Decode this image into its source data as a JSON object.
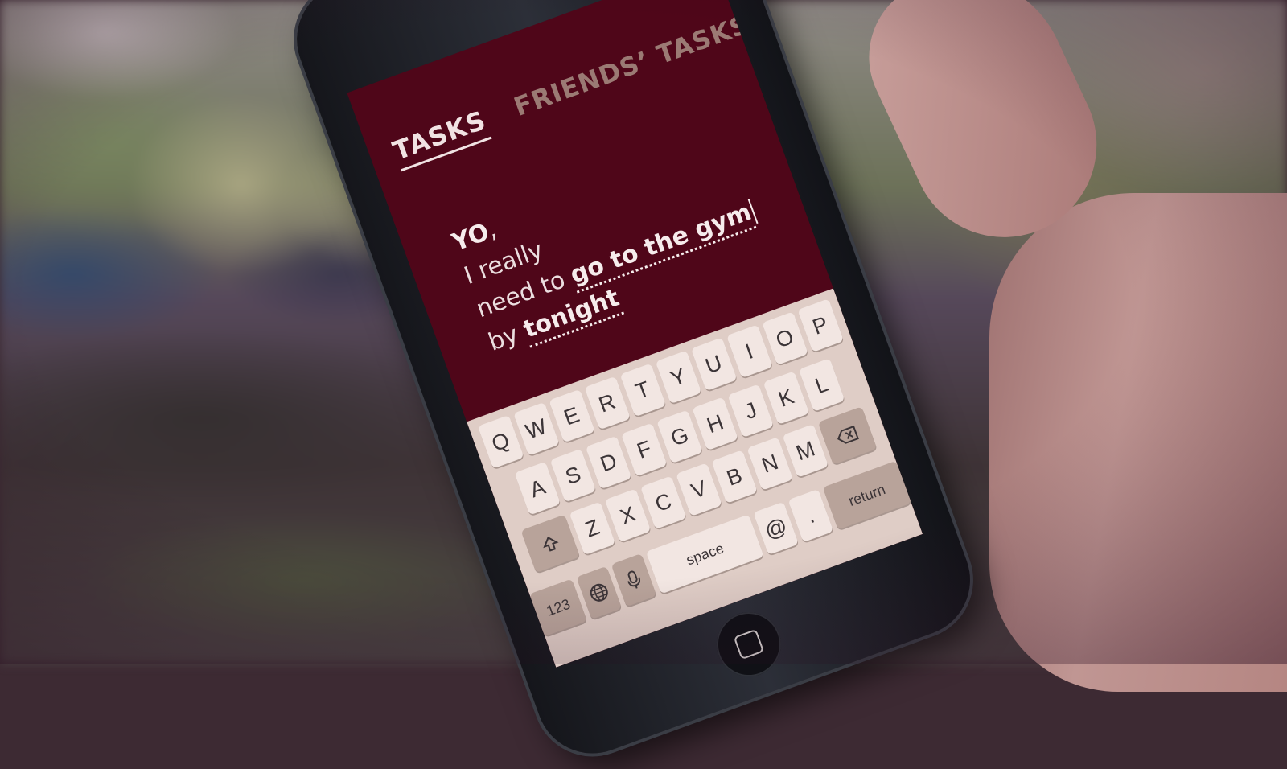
{
  "app": {
    "tabs": [
      {
        "label": "TASKS",
        "active": true
      },
      {
        "label": "FRIENDS’ TASKS",
        "active": false
      }
    ],
    "message": {
      "greeting": "YO",
      "comma": ",",
      "line1": "I really",
      "line2_prefix": "need to",
      "task": "go to the gym",
      "line3_prefix": "by",
      "deadline": "tonight"
    },
    "accent_color": "#4f0619"
  },
  "keyboard": {
    "row1": [
      "Q",
      "W",
      "E",
      "R",
      "T",
      "Y",
      "U",
      "I",
      "O",
      "P"
    ],
    "row2": [
      "A",
      "S",
      "D",
      "F",
      "G",
      "H",
      "J",
      "K",
      "L"
    ],
    "row3": [
      "Z",
      "X",
      "C",
      "V",
      "B",
      "N",
      "M"
    ],
    "shift_icon": "shift-arrow-icon",
    "backspace_icon": "backspace-icon",
    "numbers_label": "123",
    "globe_icon": "globe-icon",
    "mic_icon": "microphone-icon",
    "space_label": "space",
    "at_label": "@",
    "period_label": ".",
    "return_label": "return"
  }
}
